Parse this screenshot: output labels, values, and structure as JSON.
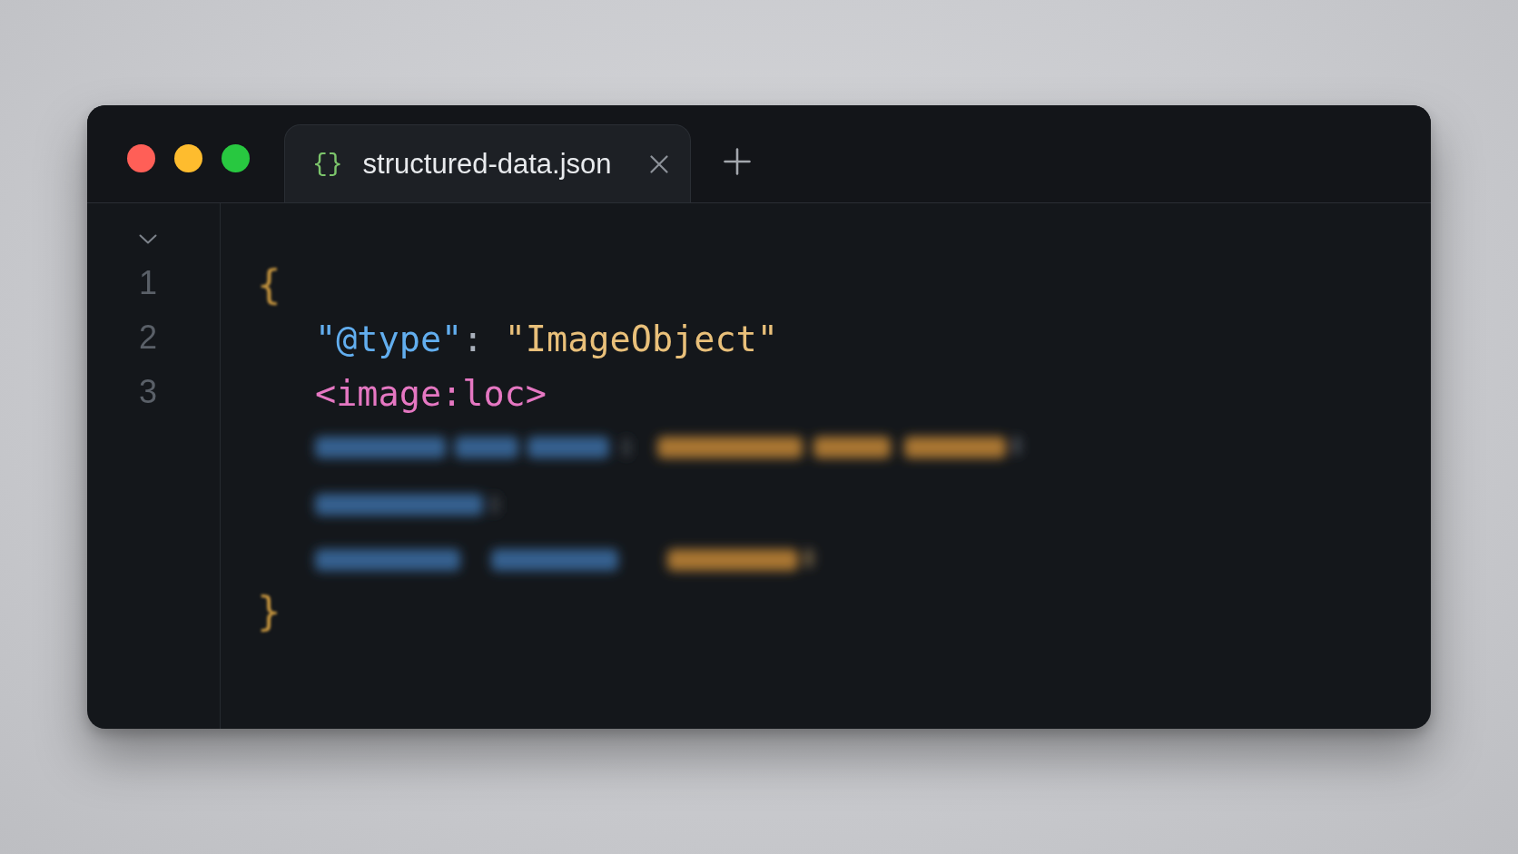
{
  "window": {
    "controls": [
      {
        "color": "#ff5f57"
      },
      {
        "color": "#febc2e"
      },
      {
        "color": "#28c840"
      }
    ],
    "tabs": [
      {
        "icon": "{}",
        "label": "structured-data.json",
        "selected": true
      }
    ]
  },
  "editor": {
    "fold": {
      "expanded": true
    },
    "line_numbers": [
      "1",
      "2",
      "3"
    ],
    "code": {
      "open": "{",
      "lines": [
        {
          "tokens": [
            {
              "kind": "key",
              "text": "\"@type\""
            },
            {
              "kind": "punct",
              "text": ": "
            },
            {
              "kind": "string",
              "text": "\"ImageObject\""
            }
          ]
        },
        {
          "tokens": [
            {
              "kind": "tag",
              "text": "<image:loc>"
            }
          ]
        }
      ],
      "close": "}"
    }
  }
}
